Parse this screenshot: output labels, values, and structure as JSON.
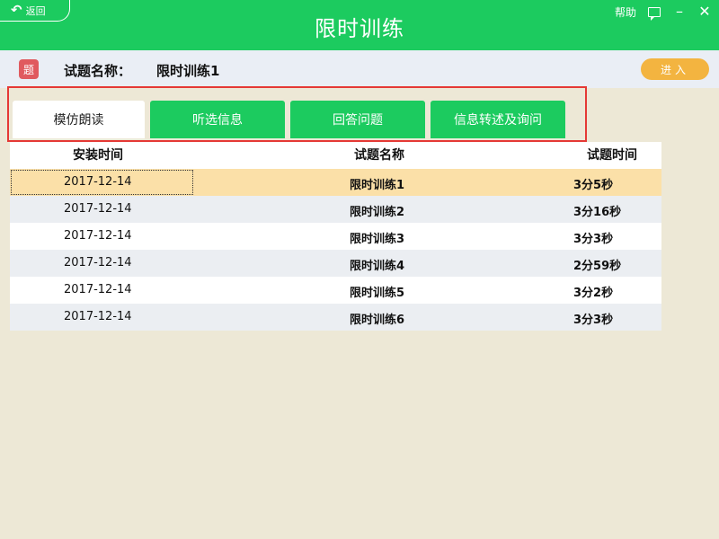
{
  "titlebar": {
    "back_label": "返回",
    "title": "限时训练",
    "help_label": "帮助"
  },
  "info": {
    "badge_text": "题",
    "label": "试题名称：",
    "name": "限时训练1",
    "enter_label": "进入"
  },
  "tabs": [
    {
      "label": "模仿朗读"
    },
    {
      "label": "听选信息"
    },
    {
      "label": "回答问题"
    },
    {
      "label": "信息转述及询问"
    }
  ],
  "table": {
    "headers": {
      "date": "安装时间",
      "name": "试题名称",
      "time": "试题时间"
    },
    "rows": [
      {
        "date": "2017-12-14",
        "name": "限时训练1",
        "time": "3分5秒"
      },
      {
        "date": "2017-12-14",
        "name": "限时训练2",
        "time": "3分16秒"
      },
      {
        "date": "2017-12-14",
        "name": "限时训练3",
        "time": "3分3秒"
      },
      {
        "date": "2017-12-14",
        "name": "限时训练4",
        "time": "2分59秒"
      },
      {
        "date": "2017-12-14",
        "name": "限时训练5",
        "time": "3分2秒"
      },
      {
        "date": "2017-12-14",
        "name": "限时训练6",
        "time": "3分3秒"
      }
    ]
  },
  "colors": {
    "brand_green": "#1ccb5f",
    "accent_orange": "#f3b440",
    "selected_row": "#fbe0a8",
    "badge_red": "#e05a5f",
    "highlight_frame": "#e53935"
  },
  "icons": [
    "back-arrow-icon",
    "message-icon",
    "minimize-icon",
    "close-icon"
  ]
}
